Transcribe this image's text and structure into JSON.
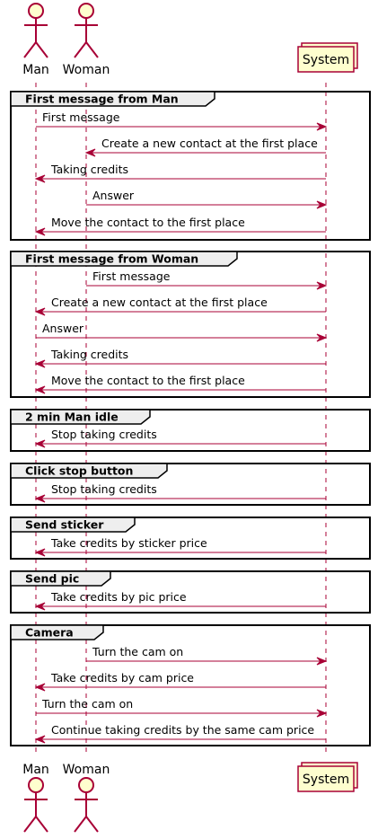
{
  "participants": [
    {
      "id": "man",
      "label": "Man",
      "kind": "actor"
    },
    {
      "id": "woman",
      "label": "Woman",
      "kind": "actor"
    },
    {
      "id": "system",
      "label": "System",
      "kind": "collections"
    }
  ],
  "colors": {
    "arrow": "#A80036",
    "actor_fill": "#FEFECE",
    "actor_stroke": "#A80036",
    "frame_stroke": "#000000",
    "frame_label_fill": "#EEEEEE",
    "lifeline": "#A80036"
  },
  "fragments": [
    {
      "label": "First message from Man",
      "messages": [
        {
          "from": "man",
          "to": "system",
          "text": "First message"
        },
        {
          "from": "system",
          "to": "woman",
          "text": "Create a new contact at the first place"
        },
        {
          "from": "system",
          "to": "man",
          "text": "Taking credits"
        },
        {
          "from": "woman",
          "to": "system",
          "text": "Answer"
        },
        {
          "from": "system",
          "to": "man",
          "text": "Move the contact to the first place"
        }
      ]
    },
    {
      "label": "First message from Woman",
      "messages": [
        {
          "from": "woman",
          "to": "system",
          "text": "First message"
        },
        {
          "from": "system",
          "to": "man",
          "text": "Create a new contact at the first place"
        },
        {
          "from": "man",
          "to": "system",
          "text": "Answer"
        },
        {
          "from": "system",
          "to": "man",
          "text": "Taking credits"
        },
        {
          "from": "system",
          "to": "man",
          "text": "Move the contact to the first place"
        }
      ]
    },
    {
      "label": "2 min Man idle",
      "messages": [
        {
          "from": "system",
          "to": "man",
          "text": "Stop taking credits"
        }
      ]
    },
    {
      "label": "Click stop button",
      "messages": [
        {
          "from": "system",
          "to": "man",
          "text": "Stop taking credits"
        }
      ]
    },
    {
      "label": "Send sticker",
      "messages": [
        {
          "from": "system",
          "to": "man",
          "text": "Take credits by sticker price"
        }
      ]
    },
    {
      "label": "Send pic",
      "messages": [
        {
          "from": "system",
          "to": "man",
          "text": "Take credits by pic price"
        }
      ]
    },
    {
      "label": "Camera",
      "messages": [
        {
          "from": "woman",
          "to": "system",
          "text": "Turn the cam on"
        },
        {
          "from": "system",
          "to": "man",
          "text": "Take credits by cam price"
        },
        {
          "from": "man",
          "to": "system",
          "text": "Turn the cam on"
        },
        {
          "from": "system",
          "to": "man",
          "text": "Continue taking credits by the same cam price"
        }
      ]
    }
  ]
}
